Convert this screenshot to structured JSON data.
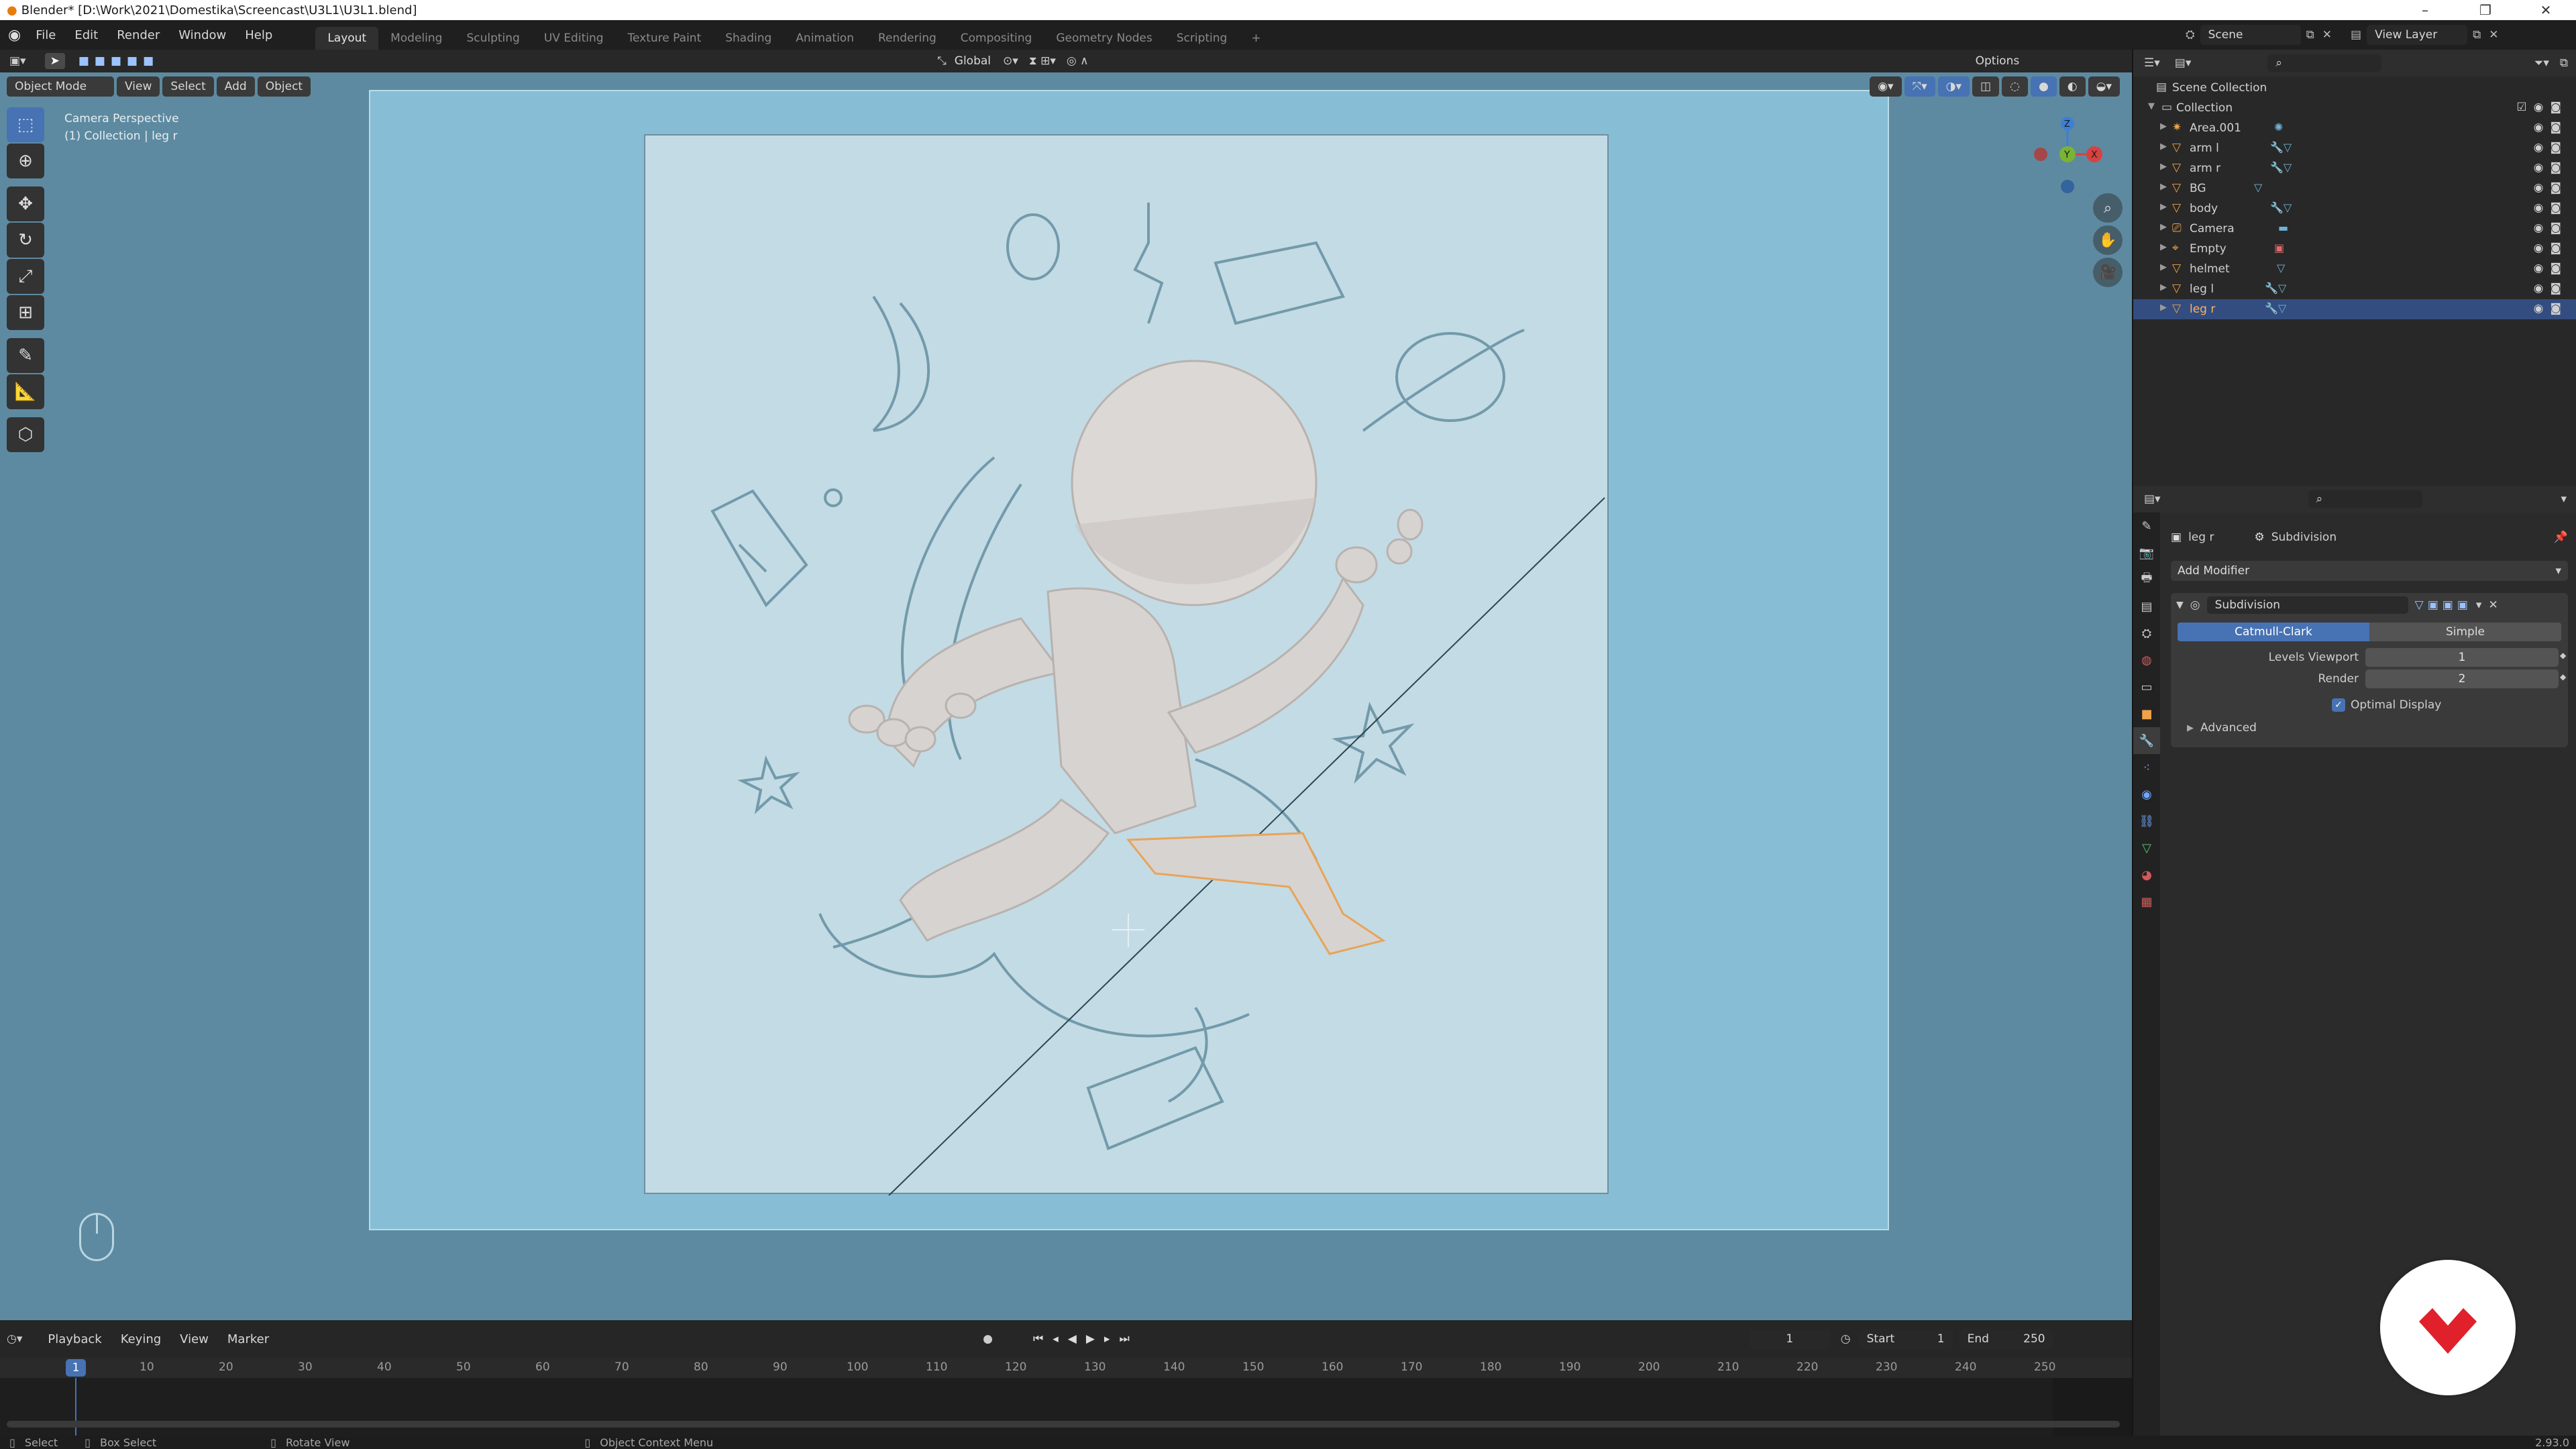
{
  "window": {
    "title": "Blender* [D:\\Work\\2021\\Domestika\\Screencast\\U3L1\\U3L1.blend]",
    "controls": [
      "–",
      "❐",
      "✕"
    ]
  },
  "menu": [
    "File",
    "Edit",
    "Render",
    "Window",
    "Help"
  ],
  "workspaces": [
    "Layout",
    "Modeling",
    "Sculpting",
    "UV Editing",
    "Texture Paint",
    "Shading",
    "Animation",
    "Rendering",
    "Compositing",
    "Geometry Nodes",
    "Scripting",
    "+"
  ],
  "active_workspace": "Layout",
  "scene": {
    "name": "Scene",
    "view_layer": "View Layer"
  },
  "tool_settings": {
    "orientation": "Global",
    "options": "Options"
  },
  "viewport": {
    "mode": "Object Mode",
    "menus": [
      "View",
      "Select",
      "Add",
      "Object"
    ],
    "info_line1": "Camera Perspective",
    "info_line2": "(1) Collection | leg r",
    "gizmo": {
      "z": "Z",
      "y": "Y",
      "x": "X"
    },
    "bg_color": "#5d8aa0"
  },
  "outliner": {
    "root": "Scene Collection",
    "collection": "Collection",
    "items": [
      {
        "name": "Area.001",
        "icon": "light-icon"
      },
      {
        "name": "arm l",
        "icon": "mesh-icon"
      },
      {
        "name": "arm r",
        "icon": "mesh-icon"
      },
      {
        "name": "BG",
        "icon": "mesh-icon"
      },
      {
        "name": "body",
        "icon": "mesh-icon"
      },
      {
        "name": "Camera",
        "icon": "camera-icon"
      },
      {
        "name": "Empty",
        "icon": "empty-icon"
      },
      {
        "name": "helmet",
        "icon": "mesh-icon"
      },
      {
        "name": "leg l",
        "icon": "mesh-icon"
      },
      {
        "name": "leg r",
        "icon": "mesh-icon",
        "selected": true
      }
    ]
  },
  "properties": {
    "object": "leg r",
    "modifier_context": "Subdivision",
    "add_modifier": "Add Modifier",
    "modifier": {
      "name": "Subdivision",
      "types": [
        "Catmull-Clark",
        "Simple"
      ],
      "active_type": "Catmull-Clark",
      "levels_viewport_label": "Levels Viewport",
      "levels_viewport": "1",
      "render_label": "Render",
      "render": "2",
      "optimal_display_label": "Optimal Display",
      "optimal_display": true,
      "advanced": "Advanced"
    }
  },
  "timeline": {
    "menus": [
      "Playback",
      "Keying",
      "View",
      "Marker"
    ],
    "current_frame": "1",
    "start_label": "Start",
    "start": "1",
    "end_label": "End",
    "end": "250",
    "ticks": [
      "10",
      "20",
      "30",
      "40",
      "50",
      "60",
      "70",
      "80",
      "90",
      "100",
      "110",
      "120",
      "130",
      "140",
      "150",
      "160",
      "170",
      "180",
      "190",
      "200",
      "210",
      "220",
      "230",
      "240",
      "250"
    ],
    "cursor": "1"
  },
  "statusbar": {
    "select": "Select",
    "box_select": "Box Select",
    "rotate_view": "Rotate View",
    "context_menu": "Object Context Menu",
    "version": "2.93.0"
  },
  "colors": {
    "accent": "#4772b3",
    "selection": "#334d80",
    "object_orange": "#f0a24a"
  }
}
